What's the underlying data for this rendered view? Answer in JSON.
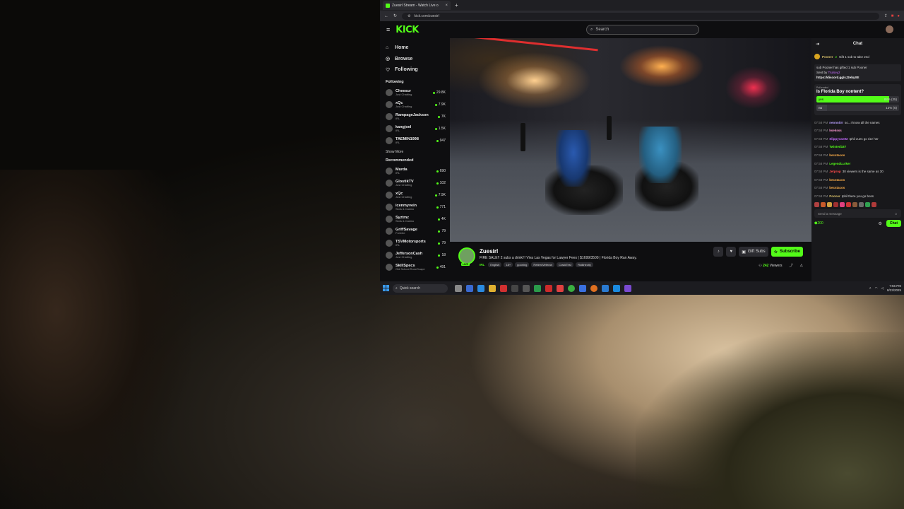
{
  "overlay": {
    "left_count": "24",
    "right_count": "2"
  },
  "browser": {
    "tab_title": "Zuesirl Stream - Watch Live o",
    "url": "kick.com/zuesirl"
  },
  "site": {
    "logo": "KICK",
    "search_placeholder": "Search"
  },
  "sidebar": {
    "nav": [
      {
        "label": "Home",
        "icon": "home-icon"
      },
      {
        "label": "Browse",
        "icon": "compass-icon"
      },
      {
        "label": "Following",
        "icon": "heart-icon"
      }
    ],
    "following_title": "Following",
    "following": [
      {
        "name": "Cheesur",
        "category": "Just Chatting",
        "viewers": "29.8K"
      },
      {
        "name": "xQc",
        "category": "Just Chatting",
        "viewers": "7.9K"
      },
      {
        "name": "RampageJackson",
        "category": "IRL",
        "viewers": "7K"
      },
      {
        "name": "kangjoel",
        "category": "IRL",
        "viewers": "1.5K"
      },
      {
        "name": "TAEMIN1998",
        "category": "IRL",
        "viewers": "947"
      }
    ],
    "show_more": "Show More",
    "recommended_title": "Recommended",
    "recommended": [
      {
        "name": "Murda",
        "category": "IRL",
        "viewers": "690"
      },
      {
        "name": "GlostikTV",
        "category": "Just Chatting",
        "viewers": "102"
      },
      {
        "name": "xQc",
        "category": "Just Chatting",
        "viewers": "7.9K"
      },
      {
        "name": "icenmyvein",
        "category": "Slots & Casino",
        "viewers": "771"
      },
      {
        "name": "Syztmz",
        "category": "Slots & Casino",
        "viewers": "4K"
      },
      {
        "name": "GriffSavage",
        "category": "Fortnite",
        "viewers": "79"
      },
      {
        "name": "TSVMotorsports",
        "category": "IRL",
        "viewers": "79"
      },
      {
        "name": "JeffersonCash",
        "category": "Just Chatting",
        "viewers": "18"
      },
      {
        "name": "SkillSpecs",
        "category": "Old School RuneScape",
        "viewers": "491"
      }
    ]
  },
  "stream": {
    "streamer": "Zuesirl",
    "live_badge": "LIVE",
    "title": "FIRE SALE!! 2 subs a drink!!! Viva Las Vegas for Lawyer Fees | $1699/3500 | Florida Boy Ran Away.",
    "category": "IRL",
    "tags": [
      "English",
      "18+",
      "gooning",
      "RetiredVeteran",
      "CrackTest",
      "Flatlinecity"
    ],
    "gift_subs_label": "Gift Subs",
    "subscribe_label": "Subscribe",
    "viewers": "242",
    "viewers_label": "Viewers"
  },
  "chat": {
    "title": "Chat",
    "pinned_user": "Pooner",
    "pinned_count": "2",
    "pinned_text": "Gift 1 sub to take 2nd",
    "gift_line": "sub Pooner has gifted 1 sub Pooner",
    "sent_by_label": "Sent by",
    "sent_by_user": "Trulsey2",
    "link": "https://discord.gg/sJ2ebyXE",
    "poll": {
      "label": "Poll ended",
      "question": "Is Florida Boy nontent?",
      "options": [
        {
          "label": "yes",
          "percent": "88%",
          "votes": "(35)",
          "fill": 0.88
        },
        {
          "label": "no",
          "percent": "13%",
          "votes": "(5)",
          "fill": 0.13
        }
      ]
    },
    "messages": [
      {
        "time": "07:58 PM",
        "user": "neonnitrr",
        "text": "so...I know all the names",
        "color": "#b9a0ff"
      },
      {
        "time": "07:58 PM",
        "user": "kseksss",
        "text": "",
        "color": "#ff9ad5"
      },
      {
        "time": "07:58 PM",
        "user": "Slippyvan92",
        "text": "Iphil zues go rizz her",
        "color": "#c56cff"
      },
      {
        "time": "07:58 PM",
        "user": "Twisted187",
        "text": "",
        "color": "#53fc18"
      },
      {
        "time": "07:58 PM",
        "user": "becstacos",
        "text": "",
        "color": "#ffb04a"
      },
      {
        "time": "07:58 PM",
        "user": "LegendLurker",
        "text": "",
        "color": "#53fc18"
      },
      {
        "time": "07:58 PM",
        "user": "Jetprop",
        "text": "30 viewers is the same as 30",
        "color": "#ff4a4a"
      },
      {
        "time": "07:58 PM",
        "user": "becstacos",
        "text": "",
        "color": "#ffb04a"
      },
      {
        "time": "07:58 PM",
        "user": "becstacos",
        "text": "",
        "color": "#ffb04a"
      },
      {
        "time": "07:58 PM",
        "user": "Pooner",
        "text": "Iphil there you go boss",
        "color": "#d9c06a"
      }
    ],
    "message_placeholder": "Send a message",
    "points": "200",
    "send_label": "Chat"
  },
  "taskbar": {
    "search_placeholder": "Quick search",
    "time": "7:56 PM",
    "date": "8/23/2025"
  },
  "colors": {
    "accent": "#53fc18",
    "bg": "#0e0e10",
    "panel": "#18181b"
  }
}
